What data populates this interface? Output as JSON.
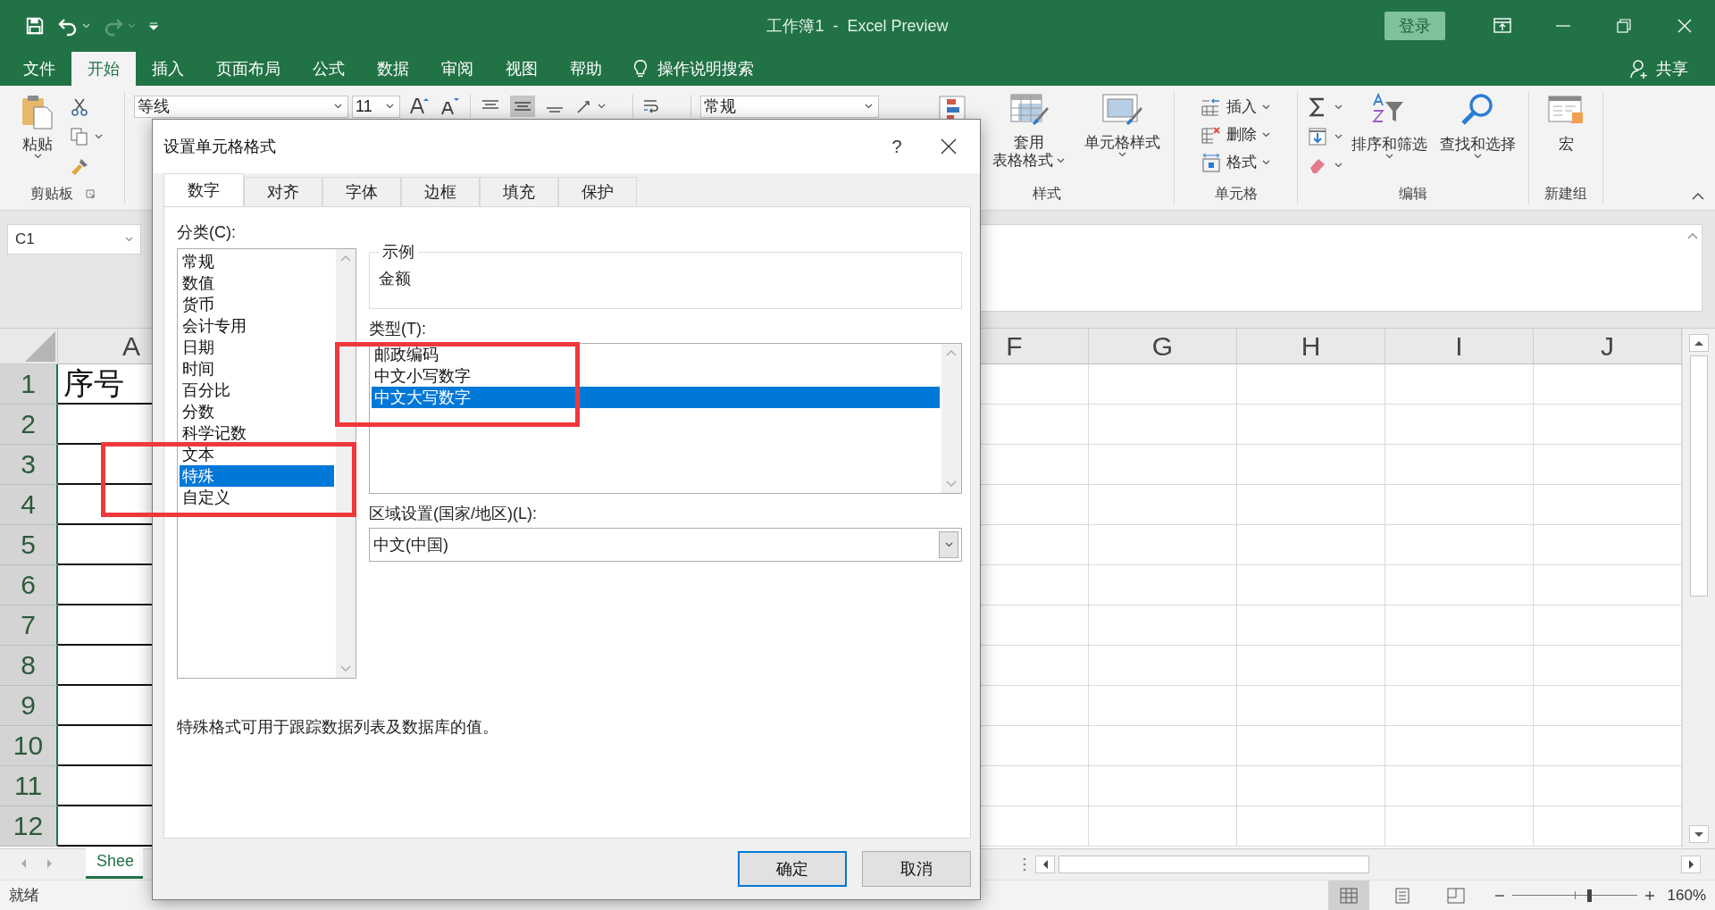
{
  "window": {
    "title": "工作簿1  -  Excel Preview",
    "sign_in": "登录"
  },
  "ribbon_tabs": [
    {
      "label": "文件",
      "selected": false
    },
    {
      "label": "开始",
      "selected": true
    },
    {
      "label": "插入",
      "selected": false
    },
    {
      "label": "页面布局",
      "selected": false
    },
    {
      "label": "公式",
      "selected": false
    },
    {
      "label": "数据",
      "selected": false
    },
    {
      "label": "审阅",
      "selected": false
    },
    {
      "label": "视图",
      "selected": false
    },
    {
      "label": "帮助",
      "selected": false
    }
  ],
  "tell_me": "操作说明搜索",
  "share": "共享",
  "ribbon": {
    "clipboard": {
      "paste": "粘贴",
      "label": "剪贴板"
    },
    "font": {
      "name": "等线",
      "size": "11"
    },
    "number_format": "常规",
    "styles": {
      "format_as_table": [
        "套用",
        "表格格式"
      ],
      "cell_styles": "单元格样式",
      "label": "样式"
    },
    "cells": {
      "buttons": [
        "插入",
        "删除",
        "格式"
      ],
      "label": "单元格"
    },
    "editing": {
      "sort": "排序和筛选",
      "find": "查找和选择",
      "label": "编辑"
    },
    "new_group": {
      "macro": "宏",
      "label": "新建组"
    }
  },
  "name_box": "C1",
  "sheet": {
    "columns": [
      "A",
      "F",
      "G",
      "H",
      "I",
      "J"
    ],
    "rows": [
      {
        "number": "1",
        "a": "序号"
      },
      {
        "number": "2"
      },
      {
        "number": "3"
      },
      {
        "number": "4"
      },
      {
        "number": "5"
      },
      {
        "number": "6"
      },
      {
        "number": "7"
      },
      {
        "number": "8"
      },
      {
        "number": "9"
      },
      {
        "number": "10"
      },
      {
        "number": "11"
      },
      {
        "number": "12"
      }
    ]
  },
  "sheet_tab": "Shee",
  "status_bar": {
    "text": "就绪",
    "views": [
      {
        "selected": true
      },
      {
        "selected": false
      },
      {
        "selected": false
      }
    ],
    "zoom": {
      "level": 0.62,
      "reading": "160%"
    }
  },
  "dialog": {
    "title": "设置单元格格式",
    "help": "?",
    "tabs": [
      {
        "label": "数字",
        "selected": true
      },
      {
        "label": "对齐",
        "selected": false
      },
      {
        "label": "字体",
        "selected": false
      },
      {
        "label": "边框",
        "selected": false
      },
      {
        "label": "填充",
        "selected": false
      },
      {
        "label": "保护",
        "selected": false
      }
    ],
    "category_label": "分类(C):",
    "categories": [
      {
        "label": "常规",
        "selected": false
      },
      {
        "label": "数值",
        "selected": false
      },
      {
        "label": "货币",
        "selected": false
      },
      {
        "label": "会计专用",
        "selected": false
      },
      {
        "label": "日期",
        "selected": false
      },
      {
        "label": "时间",
        "selected": false
      },
      {
        "label": "百分比",
        "selected": false
      },
      {
        "label": "分数",
        "selected": false
      },
      {
        "label": "科学记数",
        "selected": false
      },
      {
        "label": "文本",
        "selected": false
      },
      {
        "label": "特殊",
        "selected": true
      },
      {
        "label": "自定义",
        "selected": false
      }
    ],
    "sample_label": "示例",
    "sample": "金额",
    "type_label": "类型(T):",
    "types": [
      {
        "label": "邮政编码",
        "selected": false
      },
      {
        "label": "中文小写数字",
        "selected": false
      },
      {
        "label": "中文大写数字",
        "selected": true
      }
    ],
    "locale_label": "区域设置(国家/地区)(L):",
    "locale": "中文(中国)",
    "description": "特殊格式可用于跟踪数据列表及数据库的值。",
    "buttons": [
      {
        "label": "确定",
        "default": true
      },
      {
        "label": "取消",
        "default": false
      }
    ]
  }
}
